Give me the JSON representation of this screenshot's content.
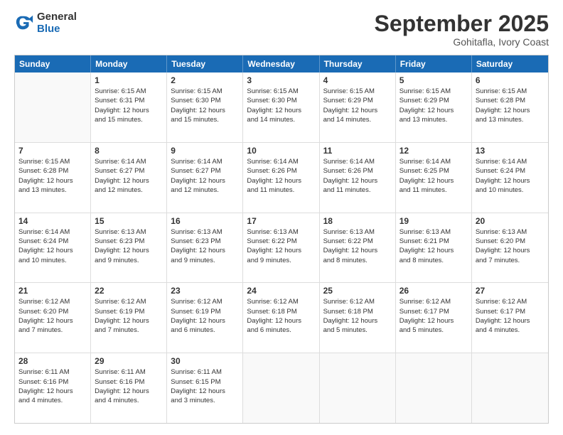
{
  "logo": {
    "general": "General",
    "blue": "Blue"
  },
  "title": "September 2025",
  "location": "Gohitafla, Ivory Coast",
  "days": [
    "Sunday",
    "Monday",
    "Tuesday",
    "Wednesday",
    "Thursday",
    "Friday",
    "Saturday"
  ],
  "weeks": [
    [
      {
        "day": "",
        "text": ""
      },
      {
        "day": "1",
        "text": "Sunrise: 6:15 AM\nSunset: 6:31 PM\nDaylight: 12 hours\nand 15 minutes."
      },
      {
        "day": "2",
        "text": "Sunrise: 6:15 AM\nSunset: 6:30 PM\nDaylight: 12 hours\nand 15 minutes."
      },
      {
        "day": "3",
        "text": "Sunrise: 6:15 AM\nSunset: 6:30 PM\nDaylight: 12 hours\nand 14 minutes."
      },
      {
        "day": "4",
        "text": "Sunrise: 6:15 AM\nSunset: 6:29 PM\nDaylight: 12 hours\nand 14 minutes."
      },
      {
        "day": "5",
        "text": "Sunrise: 6:15 AM\nSunset: 6:29 PM\nDaylight: 12 hours\nand 13 minutes."
      },
      {
        "day": "6",
        "text": "Sunrise: 6:15 AM\nSunset: 6:28 PM\nDaylight: 12 hours\nand 13 minutes."
      }
    ],
    [
      {
        "day": "7",
        "text": "Sunrise: 6:15 AM\nSunset: 6:28 PM\nDaylight: 12 hours\nand 13 minutes."
      },
      {
        "day": "8",
        "text": "Sunrise: 6:14 AM\nSunset: 6:27 PM\nDaylight: 12 hours\nand 12 minutes."
      },
      {
        "day": "9",
        "text": "Sunrise: 6:14 AM\nSunset: 6:27 PM\nDaylight: 12 hours\nand 12 minutes."
      },
      {
        "day": "10",
        "text": "Sunrise: 6:14 AM\nSunset: 6:26 PM\nDaylight: 12 hours\nand 11 minutes."
      },
      {
        "day": "11",
        "text": "Sunrise: 6:14 AM\nSunset: 6:26 PM\nDaylight: 12 hours\nand 11 minutes."
      },
      {
        "day": "12",
        "text": "Sunrise: 6:14 AM\nSunset: 6:25 PM\nDaylight: 12 hours\nand 11 minutes."
      },
      {
        "day": "13",
        "text": "Sunrise: 6:14 AM\nSunset: 6:24 PM\nDaylight: 12 hours\nand 10 minutes."
      }
    ],
    [
      {
        "day": "14",
        "text": "Sunrise: 6:14 AM\nSunset: 6:24 PM\nDaylight: 12 hours\nand 10 minutes."
      },
      {
        "day": "15",
        "text": "Sunrise: 6:13 AM\nSunset: 6:23 PM\nDaylight: 12 hours\nand 9 minutes."
      },
      {
        "day": "16",
        "text": "Sunrise: 6:13 AM\nSunset: 6:23 PM\nDaylight: 12 hours\nand 9 minutes."
      },
      {
        "day": "17",
        "text": "Sunrise: 6:13 AM\nSunset: 6:22 PM\nDaylight: 12 hours\nand 9 minutes."
      },
      {
        "day": "18",
        "text": "Sunrise: 6:13 AM\nSunset: 6:22 PM\nDaylight: 12 hours\nand 8 minutes."
      },
      {
        "day": "19",
        "text": "Sunrise: 6:13 AM\nSunset: 6:21 PM\nDaylight: 12 hours\nand 8 minutes."
      },
      {
        "day": "20",
        "text": "Sunrise: 6:13 AM\nSunset: 6:20 PM\nDaylight: 12 hours\nand 7 minutes."
      }
    ],
    [
      {
        "day": "21",
        "text": "Sunrise: 6:12 AM\nSunset: 6:20 PM\nDaylight: 12 hours\nand 7 minutes."
      },
      {
        "day": "22",
        "text": "Sunrise: 6:12 AM\nSunset: 6:19 PM\nDaylight: 12 hours\nand 7 minutes."
      },
      {
        "day": "23",
        "text": "Sunrise: 6:12 AM\nSunset: 6:19 PM\nDaylight: 12 hours\nand 6 minutes."
      },
      {
        "day": "24",
        "text": "Sunrise: 6:12 AM\nSunset: 6:18 PM\nDaylight: 12 hours\nand 6 minutes."
      },
      {
        "day": "25",
        "text": "Sunrise: 6:12 AM\nSunset: 6:18 PM\nDaylight: 12 hours\nand 5 minutes."
      },
      {
        "day": "26",
        "text": "Sunrise: 6:12 AM\nSunset: 6:17 PM\nDaylight: 12 hours\nand 5 minutes."
      },
      {
        "day": "27",
        "text": "Sunrise: 6:12 AM\nSunset: 6:17 PM\nDaylight: 12 hours\nand 4 minutes."
      }
    ],
    [
      {
        "day": "28",
        "text": "Sunrise: 6:11 AM\nSunset: 6:16 PM\nDaylight: 12 hours\nand 4 minutes."
      },
      {
        "day": "29",
        "text": "Sunrise: 6:11 AM\nSunset: 6:16 PM\nDaylight: 12 hours\nand 4 minutes."
      },
      {
        "day": "30",
        "text": "Sunrise: 6:11 AM\nSunset: 6:15 PM\nDaylight: 12 hours\nand 3 minutes."
      },
      {
        "day": "",
        "text": ""
      },
      {
        "day": "",
        "text": ""
      },
      {
        "day": "",
        "text": ""
      },
      {
        "day": "",
        "text": ""
      }
    ]
  ]
}
